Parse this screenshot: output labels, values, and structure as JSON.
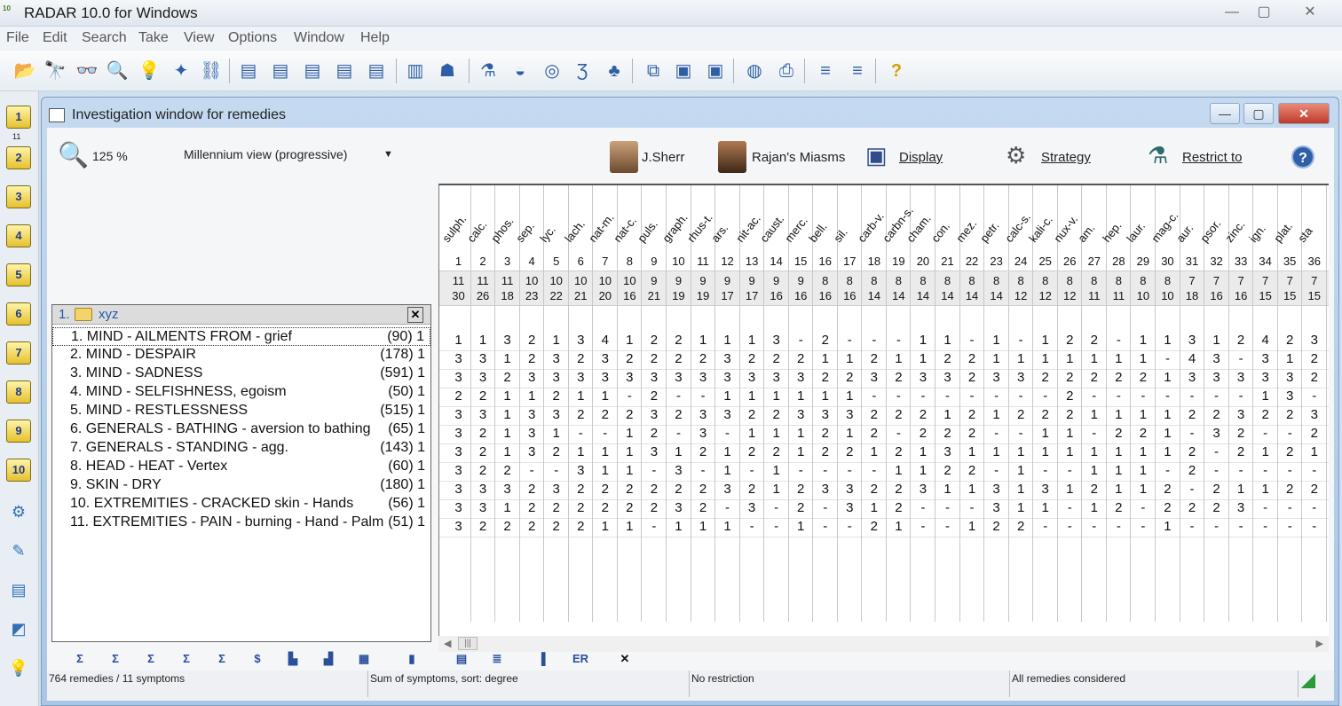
{
  "app": {
    "title": "RADAR 10.0 for Windows",
    "icon_text": "10"
  },
  "window_controls": {
    "minimize": "—",
    "maximize": "▢",
    "close": "✕"
  },
  "menu": [
    "File",
    "Edit",
    "Search",
    "Take",
    "View",
    "Options",
    "Window",
    "Help"
  ],
  "toolbar_icons": [
    "open-folder-icon",
    "binoculars-icon",
    "glasses-icon",
    "magnifier-icon",
    "lightbulb-icon",
    "idea-icon",
    "link-icon",
    "clip-new-icon",
    "clip-1-icon",
    "clip-2-icon",
    "clip-3-icon",
    "clip-4-icon",
    "bar-chart-icon",
    "family-icon",
    "flask-icon",
    "hat-icon",
    "lifebuoy-icon",
    "symbol-icon",
    "plant-icon",
    "copy-icon",
    "window-icon",
    "window2-icon",
    "globe-icon",
    "printer-icon",
    "ruler-icon",
    "ruler2-icon",
    "help-icon"
  ],
  "leftbar": {
    "clips": [
      "1",
      "2",
      "3",
      "4",
      "5",
      "6",
      "7",
      "8",
      "9",
      "10"
    ],
    "badge": "11",
    "extra_icons": [
      "tools-icon",
      "pencil-icon",
      "sheets-icon",
      "chart-edit-icon",
      "lightbulb-small-icon"
    ]
  },
  "child_window": {
    "title": "Investigation window for remedies"
  },
  "header": {
    "zoom": "125 %",
    "view": "Millennium view (progressive)",
    "sherr": "J.Sherr",
    "miasms": "Rajan's Miasms",
    "display": "Display",
    "strategy": "Strategy",
    "restrict": "Restrict to",
    "help": "?"
  },
  "folder": {
    "num": "1.",
    "name": "xyz",
    "close": "✕"
  },
  "symptoms": [
    {
      "text": "1. MIND - AILMENTS FROM - grief",
      "count": "(90) 1"
    },
    {
      "text": "2. MIND - DESPAIR",
      "count": "(178) 1"
    },
    {
      "text": "3. MIND - SADNESS",
      "count": "(591) 1"
    },
    {
      "text": "4. MIND - SELFISHNESS, egoism",
      "count": "(50) 1"
    },
    {
      "text": "5. MIND - RESTLESSNESS",
      "count": "(515) 1"
    },
    {
      "text": "6. GENERALS - BATHING - aversion to bathing",
      "count": "(65) 1"
    },
    {
      "text": "7. GENERALS - STANDING - agg.",
      "count": "(143) 1"
    },
    {
      "text": "8. HEAD - HEAT - Vertex",
      "count": "(60) 1"
    },
    {
      "text": "9. SKIN - DRY",
      "count": "(180) 1"
    },
    {
      "text": "10. EXTREMITIES - CRACKED skin - Hands",
      "count": "(56) 1"
    },
    {
      "text": "11. EXTREMITIES - PAIN - burning - Hand - Palm",
      "count": "(51) 1"
    }
  ],
  "remedies": [
    {
      "name": "sulph.",
      "idx": "1",
      "s1": "11",
      "s2": "30"
    },
    {
      "name": "calc.",
      "idx": "2",
      "s1": "11",
      "s2": "26"
    },
    {
      "name": "phos.",
      "idx": "3",
      "s1": "11",
      "s2": "18"
    },
    {
      "name": "sep.",
      "idx": "4",
      "s1": "10",
      "s2": "23"
    },
    {
      "name": "lyc.",
      "idx": "5",
      "s1": "10",
      "s2": "22"
    },
    {
      "name": "lach.",
      "idx": "6",
      "s1": "10",
      "s2": "21"
    },
    {
      "name": "nat-m.",
      "idx": "7",
      "s1": "10",
      "s2": "20"
    },
    {
      "name": "nat-c.",
      "idx": "8",
      "s1": "10",
      "s2": "16"
    },
    {
      "name": "puls.",
      "idx": "9",
      "s1": "9",
      "s2": "21"
    },
    {
      "name": "graph.",
      "idx": "10",
      "s1": "9",
      "s2": "19"
    },
    {
      "name": "rhus-t.",
      "idx": "11",
      "s1": "9",
      "s2": "19"
    },
    {
      "name": "ars.",
      "idx": "12",
      "s1": "9",
      "s2": "17"
    },
    {
      "name": "nit-ac.",
      "idx": "13",
      "s1": "9",
      "s2": "17"
    },
    {
      "name": "caust.",
      "idx": "14",
      "s1": "9",
      "s2": "16"
    },
    {
      "name": "merc.",
      "idx": "15",
      "s1": "9",
      "s2": "16"
    },
    {
      "name": "bell.",
      "idx": "16",
      "s1": "8",
      "s2": "16"
    },
    {
      "name": "sil.",
      "idx": "17",
      "s1": "8",
      "s2": "16"
    },
    {
      "name": "carb-v.",
      "idx": "18",
      "s1": "8",
      "s2": "14"
    },
    {
      "name": "carbn-s.",
      "idx": "19",
      "s1": "8",
      "s2": "14"
    },
    {
      "name": "cham.",
      "idx": "20",
      "s1": "8",
      "s2": "14"
    },
    {
      "name": "con.",
      "idx": "21",
      "s1": "8",
      "s2": "14"
    },
    {
      "name": "mez.",
      "idx": "22",
      "s1": "8",
      "s2": "14"
    },
    {
      "name": "petr.",
      "idx": "23",
      "s1": "8",
      "s2": "14"
    },
    {
      "name": "calc-s.",
      "idx": "24",
      "s1": "8",
      "s2": "12"
    },
    {
      "name": "kali-c.",
      "idx": "25",
      "s1": "8",
      "s2": "12"
    },
    {
      "name": "nux-v.",
      "idx": "26",
      "s1": "8",
      "s2": "12"
    },
    {
      "name": "am.",
      "idx": "27",
      "s1": "8",
      "s2": "11"
    },
    {
      "name": "hep.",
      "idx": "28",
      "s1": "8",
      "s2": "11"
    },
    {
      "name": "laur.",
      "idx": "29",
      "s1": "8",
      "s2": "10"
    },
    {
      "name": "mag-c.",
      "idx": "30",
      "s1": "8",
      "s2": "10"
    },
    {
      "name": "aur.",
      "idx": "31",
      "s1": "7",
      "s2": "18"
    },
    {
      "name": "psor.",
      "idx": "32",
      "s1": "7",
      "s2": "16"
    },
    {
      "name": "zinc.",
      "idx": "33",
      "s1": "7",
      "s2": "16"
    },
    {
      "name": "ign.",
      "idx": "34",
      "s1": "7",
      "s2": "15"
    },
    {
      "name": "plat.",
      "idx": "35",
      "s1": "7",
      "s2": "15"
    },
    {
      "name": "sta",
      "idx": "36",
      "s1": "7",
      "s2": "15"
    }
  ],
  "grid_rows": [
    [
      "1",
      "1",
      "3",
      "2",
      "1",
      "3",
      "4",
      "1",
      "2",
      "2",
      "1",
      "1",
      "1",
      "3",
      "-",
      "2",
      "-",
      "-",
      "-",
      "1",
      "1",
      "-",
      "1",
      "-",
      "1",
      "2",
      "2",
      "-",
      "1",
      "1",
      "3",
      "1",
      "2",
      "4",
      "2",
      "3"
    ],
    [
      "3",
      "3",
      "1",
      "2",
      "3",
      "2",
      "3",
      "2",
      "2",
      "2",
      "2",
      "3",
      "2",
      "2",
      "2",
      "1",
      "1",
      "2",
      "1",
      "1",
      "2",
      "2",
      "1",
      "1",
      "1",
      "1",
      "1",
      "1",
      "1",
      "-",
      "4",
      "3",
      "-",
      "3",
      "1",
      "2"
    ],
    [
      "3",
      "3",
      "2",
      "3",
      "3",
      "3",
      "3",
      "3",
      "3",
      "3",
      "3",
      "3",
      "3",
      "3",
      "3",
      "2",
      "2",
      "3",
      "2",
      "3",
      "3",
      "2",
      "3",
      "3",
      "2",
      "2",
      "2",
      "2",
      "2",
      "1",
      "3",
      "3",
      "3",
      "3",
      "3",
      "2"
    ],
    [
      "2",
      "2",
      "1",
      "1",
      "2",
      "1",
      "1",
      "-",
      "2",
      "-",
      "-",
      "1",
      "1",
      "1",
      "1",
      "1",
      "1",
      "-",
      "-",
      "-",
      "-",
      "-",
      "-",
      "-",
      "-",
      "2",
      "-",
      "-",
      "-",
      "-",
      "-",
      "-",
      "-",
      "1",
      "3",
      "-"
    ],
    [
      "3",
      "3",
      "1",
      "3",
      "3",
      "2",
      "2",
      "2",
      "3",
      "2",
      "3",
      "3",
      "2",
      "2",
      "3",
      "3",
      "3",
      "2",
      "2",
      "2",
      "1",
      "2",
      "1",
      "2",
      "2",
      "2",
      "1",
      "1",
      "1",
      "1",
      "2",
      "2",
      "3",
      "2",
      "2",
      "3"
    ],
    [
      "3",
      "2",
      "1",
      "3",
      "1",
      "-",
      "-",
      "1",
      "2",
      "-",
      "3",
      "-",
      "1",
      "1",
      "1",
      "2",
      "1",
      "2",
      "-",
      "2",
      "2",
      "2",
      "-",
      "-",
      "1",
      "1",
      "-",
      "2",
      "2",
      "1",
      "-",
      "3",
      "2",
      "-",
      "-",
      "2"
    ],
    [
      "3",
      "2",
      "1",
      "3",
      "2",
      "1",
      "1",
      "1",
      "3",
      "1",
      "2",
      "1",
      "2",
      "2",
      "1",
      "2",
      "2",
      "1",
      "2",
      "1",
      "3",
      "1",
      "1",
      "1",
      "1",
      "1",
      "1",
      "1",
      "1",
      "1",
      "2",
      "-",
      "2",
      "1",
      "2",
      "1"
    ],
    [
      "3",
      "2",
      "2",
      "-",
      "-",
      "3",
      "1",
      "1",
      "-",
      "3",
      "-",
      "1",
      "-",
      "1",
      "-",
      "-",
      "-",
      "-",
      "1",
      "1",
      "2",
      "2",
      "-",
      "1",
      "-",
      "-",
      "1",
      "1",
      "1",
      "-",
      "2",
      "-",
      "-",
      "-",
      "-",
      "-"
    ],
    [
      "3",
      "3",
      "3",
      "2",
      "3",
      "2",
      "2",
      "2",
      "2",
      "2",
      "2",
      "3",
      "2",
      "1",
      "2",
      "3",
      "3",
      "2",
      "2",
      "3",
      "1",
      "1",
      "3",
      "1",
      "3",
      "1",
      "2",
      "1",
      "1",
      "2",
      "-",
      "2",
      "1",
      "1",
      "2",
      "2"
    ],
    [
      "3",
      "3",
      "1",
      "2",
      "2",
      "2",
      "2",
      "2",
      "2",
      "3",
      "2",
      "-",
      "3",
      "-",
      "2",
      "-",
      "3",
      "1",
      "2",
      "-",
      "-",
      "-",
      "3",
      "1",
      "1",
      "-",
      "1",
      "2",
      "-",
      "2",
      "2",
      "2",
      "3",
      "-",
      "-",
      "-"
    ],
    [
      "3",
      "2",
      "2",
      "2",
      "2",
      "2",
      "1",
      "1",
      "-",
      "1",
      "1",
      "1",
      "-",
      "-",
      "1",
      "-",
      "-",
      "2",
      "1",
      "-",
      "-",
      "1",
      "2",
      "2",
      "-",
      "-",
      "-",
      "-",
      "-",
      "1",
      "-",
      "-",
      "-",
      "-",
      "-",
      "-"
    ]
  ],
  "bottom_tools": [
    {
      "name": "sum-icon",
      "text": "Σ"
    },
    {
      "name": "sum-sort-icon",
      "text": "Σ"
    },
    {
      "name": "sum-degree-icon",
      "text": "Σ"
    },
    {
      "name": "sum-filter-icon",
      "text": "Σ"
    },
    {
      "name": "sum-plus-icon",
      "text": "Σ"
    },
    {
      "name": "dollar-icon",
      "text": "$"
    },
    {
      "name": "chart-a-icon",
      "text": "▙"
    },
    {
      "name": "chart-b-icon",
      "text": "▟"
    },
    {
      "name": "grid-icon",
      "text": "▦"
    },
    {
      "name": "column-icon",
      "text": "▮"
    },
    {
      "name": "copy-grid-icon",
      "text": "▤"
    },
    {
      "name": "numbers-icon",
      "text": "≣"
    },
    {
      "name": "bars-icon",
      "text": "▐"
    },
    {
      "name": "era-icon",
      "text": "ER"
    },
    {
      "name": "close-x-icon",
      "text": "✕"
    }
  ],
  "status": {
    "remedies": "764 remedies / 11 symptoms",
    "sort": "Sum of symptoms, sort: degree",
    "restriction": "No restriction",
    "considered": "All remedies considered"
  }
}
